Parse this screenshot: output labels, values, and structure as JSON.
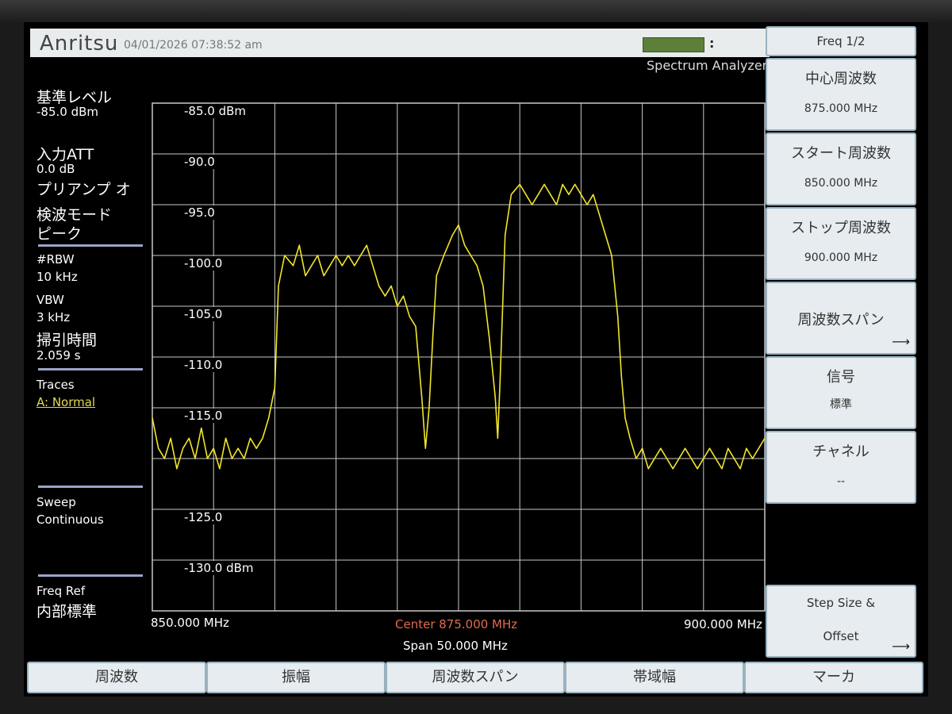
{
  "header": {
    "logo_text": "Anritsu",
    "datetime": "04/01/2026 07:38:52 am",
    "status_colon": ":",
    "mode": "Spectrum Analyzer"
  },
  "left_panel": {
    "ref_level_label": "基準レベル",
    "ref_level_value": "-85.0 dBm",
    "input_att_label": "入力ATT",
    "input_att_value": "0.0 dB",
    "preamp_label": "プリアンプ オ",
    "detect_mode_label": "検波モード",
    "detect_mode_value": "ピーク",
    "rbw_label": "#RBW",
    "rbw_value": "10 kHz",
    "vbw_label": "VBW",
    "vbw_value": "3 kHz",
    "sweep_time_label": "掃引時間",
    "sweep_time_value": "2.059 s",
    "traces_label": "Traces",
    "traces_value": "A: Normal",
    "sweep_label": "Sweep",
    "sweep_value": "Continuous",
    "freq_ref_label": "Freq Ref",
    "freq_ref_value": "内部標準"
  },
  "graph": {
    "y_labels": [
      "-85.0 dBm",
      "-90.0",
      "-95.0",
      "-100.0",
      "-105.0",
      "-110.0",
      "-115.0",
      "",
      "-125.0",
      "-130.0 dBm"
    ],
    "x_start": "850.000 MHz",
    "x_center": "Center 875.000 MHz",
    "x_stop": "900.000 MHz",
    "span": "Span 50.000 MHz",
    "trace_color": "#f2e62a",
    "grid_color": "#c8c8c8"
  },
  "chart_data": {
    "type": "line",
    "title": "",
    "xlabel": "",
    "ylabel": "",
    "xlim": [
      850,
      900
    ],
    "ylim": [
      -135,
      -85
    ],
    "grid": true,
    "series": [
      {
        "values": [
          [
            850.0,
            -116
          ],
          [
            850.5,
            -119
          ],
          [
            851.0,
            -120
          ],
          [
            851.5,
            -118
          ],
          [
            852.0,
            -121
          ],
          [
            852.5,
            -119
          ],
          [
            853.0,
            -118
          ],
          [
            853.5,
            -120
          ],
          [
            854.0,
            -117
          ],
          [
            854.5,
            -120
          ],
          [
            855.0,
            -119
          ],
          [
            855.5,
            -121
          ],
          [
            856.0,
            -118
          ],
          [
            856.5,
            -120
          ],
          [
            857.0,
            -119
          ],
          [
            857.5,
            -120
          ],
          [
            858.0,
            -118
          ],
          [
            858.5,
            -119
          ],
          [
            859.0,
            -118
          ],
          [
            859.5,
            -116
          ],
          [
            860.0,
            -113
          ],
          [
            860.3,
            -103
          ],
          [
            860.8,
            -100
          ],
          [
            861.5,
            -101
          ],
          [
            862.0,
            -99
          ],
          [
            862.5,
            -102
          ],
          [
            863.0,
            -101
          ],
          [
            863.5,
            -100
          ],
          [
            864.0,
            -102
          ],
          [
            864.5,
            -101
          ],
          [
            865.0,
            -100
          ],
          [
            865.5,
            -101
          ],
          [
            866.0,
            -100
          ],
          [
            866.5,
            -101
          ],
          [
            867.0,
            -100
          ],
          [
            867.5,
            -99
          ],
          [
            868.0,
            -101
          ],
          [
            868.5,
            -103
          ],
          [
            869.0,
            -104
          ],
          [
            869.5,
            -103
          ],
          [
            870.0,
            -105
          ],
          [
            870.5,
            -104
          ],
          [
            871.0,
            -106
          ],
          [
            871.5,
            -107
          ],
          [
            872.0,
            -114
          ],
          [
            872.3,
            -119
          ],
          [
            872.6,
            -115
          ],
          [
            872.9,
            -108
          ],
          [
            873.2,
            -102
          ],
          [
            873.8,
            -100
          ],
          [
            874.5,
            -98
          ],
          [
            875.0,
            -97
          ],
          [
            875.5,
            -99
          ],
          [
            876.0,
            -100
          ],
          [
            876.5,
            -101
          ],
          [
            877.0,
            -103
          ],
          [
            877.5,
            -108
          ],
          [
            878.0,
            -114
          ],
          [
            878.2,
            -118
          ],
          [
            878.4,
            -112
          ],
          [
            878.8,
            -98
          ],
          [
            879.3,
            -94
          ],
          [
            880.0,
            -93
          ],
          [
            880.5,
            -94
          ],
          [
            881.0,
            -95
          ],
          [
            881.5,
            -94
          ],
          [
            882.0,
            -93
          ],
          [
            882.5,
            -94
          ],
          [
            883.0,
            -95
          ],
          [
            883.5,
            -93
          ],
          [
            884.0,
            -94
          ],
          [
            884.5,
            -93
          ],
          [
            885.0,
            -94
          ],
          [
            885.5,
            -95
          ],
          [
            886.0,
            -94
          ],
          [
            886.5,
            -96
          ],
          [
            887.0,
            -98
          ],
          [
            887.5,
            -100
          ],
          [
            888.0,
            -106
          ],
          [
            888.3,
            -112
          ],
          [
            888.6,
            -116
          ],
          [
            889.0,
            -118
          ],
          [
            889.5,
            -120
          ],
          [
            890.0,
            -119
          ],
          [
            890.5,
            -121
          ],
          [
            891.0,
            -120
          ],
          [
            891.5,
            -119
          ],
          [
            892.0,
            -120
          ],
          [
            892.5,
            -121
          ],
          [
            893.0,
            -120
          ],
          [
            893.5,
            -119
          ],
          [
            894.0,
            -120
          ],
          [
            894.5,
            -121
          ],
          [
            895.0,
            -120
          ],
          [
            895.5,
            -119
          ],
          [
            896.0,
            -120
          ],
          [
            896.5,
            -121
          ],
          [
            897.0,
            -119
          ],
          [
            897.5,
            -120
          ],
          [
            898.0,
            -121
          ],
          [
            898.5,
            -119
          ],
          [
            899.0,
            -120
          ],
          [
            899.5,
            -119
          ],
          [
            900.0,
            -118
          ]
        ]
      }
    ]
  },
  "softkeys": {
    "header": "Freq 1/2",
    "keys": [
      {
        "title": "中心周波数",
        "sub": "875.000 MHz"
      },
      {
        "title": "スタート周波数",
        "sub": "850.000 MHz"
      },
      {
        "title": "ストップ周波数",
        "sub": "900.000 MHz"
      },
      {
        "title": "周波数スパン",
        "sub": ""
      },
      {
        "title": "信号",
        "sub": "標準"
      },
      {
        "title": "チャネル",
        "sub": "--"
      },
      {
        "title": "Step Size &",
        "sub": "Offset"
      }
    ]
  },
  "bottom_tabs": [
    "周波数",
    "振幅",
    "周波数スパン",
    "帯域幅",
    "マーカ"
  ]
}
